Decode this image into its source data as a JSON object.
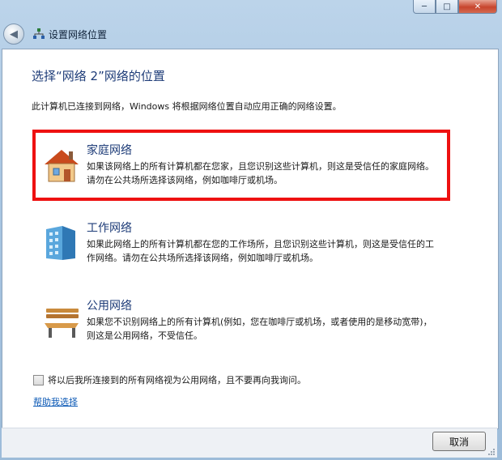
{
  "window": {
    "title": "设置网络位置",
    "caption": {
      "minimize": "─",
      "maximize": "□",
      "close": "✕"
    },
    "back_icon": "back-arrow-icon"
  },
  "main": {
    "heading": "选择“网络 2”网络的位置",
    "intro": "此计算机已连接到网络，Windows 将根据网络位置自动应用正确的网络设置。",
    "options": [
      {
        "icon": "house-icon",
        "title": "家庭网络",
        "description": "如果该网络上的所有计算机都在您家，且您识别这些计算机，则这是受信任的家庭网络。请勿在公共场所选择该网络，例如咖啡厅或机场。"
      },
      {
        "icon": "office-building-icon",
        "title": "工作网络",
        "description": "如果此网络上的所有计算机都在您的工作场所，且您识别这些计算机，则这是受信任的工作网络。请勿在公共场所选择该网络，例如咖啡厅或机场。"
      },
      {
        "icon": "park-bench-icon",
        "title": "公用网络",
        "description": "如果您不识别网络上的所有计算机(例如，您在咖啡厅或机场，或者使用的是移动宽带)，则这是公用网络，不受信任。"
      }
    ],
    "checkbox_label": "将以后我所连接到的所有网络视为公用网络，且不要再向我询问。",
    "checkbox_checked": false,
    "help_link": "帮助我选择"
  },
  "footer": {
    "cancel_label": "取消"
  },
  "colors": {
    "heading": "#1e3c78",
    "highlight_border": "#ee1111",
    "link": "#0a58b5"
  }
}
